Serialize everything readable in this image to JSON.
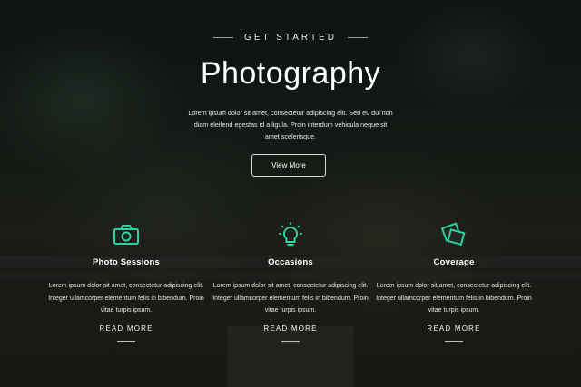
{
  "hero": {
    "eyebrow": "GET STARTED",
    "title": "Photography",
    "lead": "Lorem ipsum dolor sit amet, consectetur adipiscing elit. Sed eu dui non diam eleifend egestas id a ligula. Proin interdum vehicula neque sit amet scelerisque.",
    "button_label": "View More"
  },
  "accent_color": "#2ecfa0",
  "features": [
    {
      "icon": "camera-icon",
      "title": "Photo Sessions",
      "text": "Lorem ipsum dolor sit amet, consectetur adipiscing elit. Integer ullamcorper elementum felis in bibendum. Proin vitae turpis ipsum.",
      "link_label": "READ MORE"
    },
    {
      "icon": "lightbulb-icon",
      "title": "Occasions",
      "text": "Lorem ipsum dolor sit amet, consectetur adipiscing elit. Integer ullamcorper elementum felis in bibendum. Proin vitae turpis ipsum.",
      "link_label": "READ MORE"
    },
    {
      "icon": "photos-icon",
      "title": "Coverage",
      "text": "Lorem ipsum dolor sit amet, consectetur adipiscing elit. Integer ullamcorper elementum felis in bibendum. Proin vitae turpis ipsum.",
      "link_label": "READ MORE"
    }
  ]
}
